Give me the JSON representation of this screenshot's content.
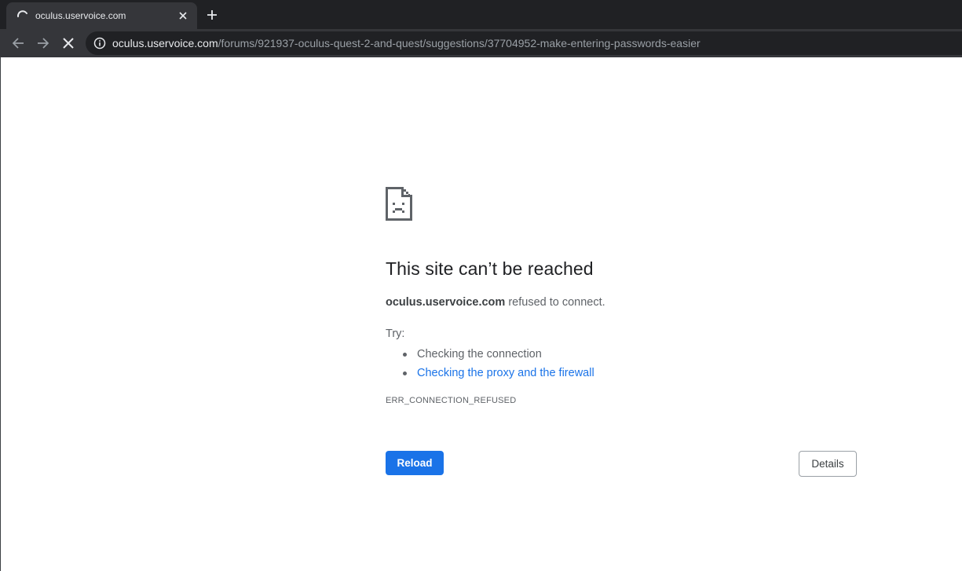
{
  "tab": {
    "title": "oculus.uservoice.com",
    "close_icon": "close-icon",
    "loading_icon": "loading-spinner-icon"
  },
  "new_tab_icon": "plus-icon",
  "toolbar": {
    "back_icon": "back-arrow-icon",
    "forward_icon": "forward-arrow-icon",
    "stop_icon": "stop-loading-icon",
    "info_icon": "info-icon"
  },
  "omnibox": {
    "url_host": "oculus.uservoice.com",
    "url_path": "/forums/921937-oculus-quest-2-and-quest/suggestions/37704952-make-entering-passwords-easier"
  },
  "error": {
    "icon": "sad-page-icon",
    "heading": "This site can’t be reached",
    "host": "oculus.uservoice.com",
    "summary_suffix": " refused to connect.",
    "try_label": "Try:",
    "suggestions": [
      "Checking the connection",
      "Checking the proxy and the firewall"
    ],
    "code": "ERR_CONNECTION_REFUSED"
  },
  "buttons": {
    "reload": "Reload",
    "details": "Details"
  },
  "colors": {
    "chrome_dark": "#202124",
    "chrome_tab": "#35363a",
    "accent_blue": "#1a73e8",
    "text_primary": "#202124",
    "text_secondary": "#5f6368"
  }
}
